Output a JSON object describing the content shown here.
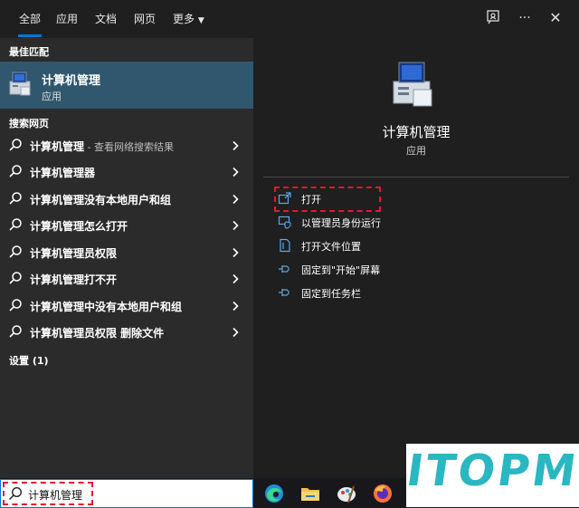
{
  "tabs": [
    {
      "label": "全部",
      "active": true
    },
    {
      "label": "应用"
    },
    {
      "label": "文档"
    },
    {
      "label": "网页"
    },
    {
      "label": "更多"
    }
  ],
  "top_icons": {
    "feedback": "feedback-icon",
    "more": "···",
    "close": "✕"
  },
  "left": {
    "best_match_header": "最佳匹配",
    "best_match": {
      "title": "计算机管理",
      "subtitle": "应用"
    },
    "web_header": "搜索网页",
    "web_results": [
      {
        "bold": "计算机管理",
        "hint": " - 查看网络搜索结果"
      },
      {
        "bold": "计算机管理器",
        "hint": ""
      },
      {
        "bold": "计算机管理没有本地用户和组",
        "hint": ""
      },
      {
        "bold": "计算机管理怎么打开",
        "hint": ""
      },
      {
        "bold": "计算机管理员权限",
        "hint": ""
      },
      {
        "bold": "计算机管理打不开",
        "hint": ""
      },
      {
        "bold": "计算机管理中没有本地用户和组",
        "hint": ""
      },
      {
        "bold": "计算机管理员权限 删除文件",
        "hint": ""
      }
    ],
    "settings_header": "设置 (1)"
  },
  "right": {
    "app_title": "计算机管理",
    "app_subtitle": "应用",
    "actions": [
      {
        "label": "打开",
        "icon": "open-icon"
      },
      {
        "label": "以管理员身份运行",
        "icon": "run-as-admin-icon"
      },
      {
        "label": "打开文件位置",
        "icon": "file-location-icon"
      },
      {
        "label": "固定到\"开始\"屏幕",
        "icon": "pin-icon"
      },
      {
        "label": "固定到任务栏",
        "icon": "pin-icon"
      }
    ]
  },
  "search": {
    "value": "计算机管理"
  },
  "taskbar_icons": [
    "edge-icon",
    "file-explorer-icon",
    "paint-icon",
    "firefox-icon"
  ],
  "watermark": {
    "text": "ITOPM"
  },
  "colors": {
    "accent": "#0078d4",
    "selected": "#31576e",
    "highlight": "#e5192c",
    "watermark": "#29b7c2"
  }
}
